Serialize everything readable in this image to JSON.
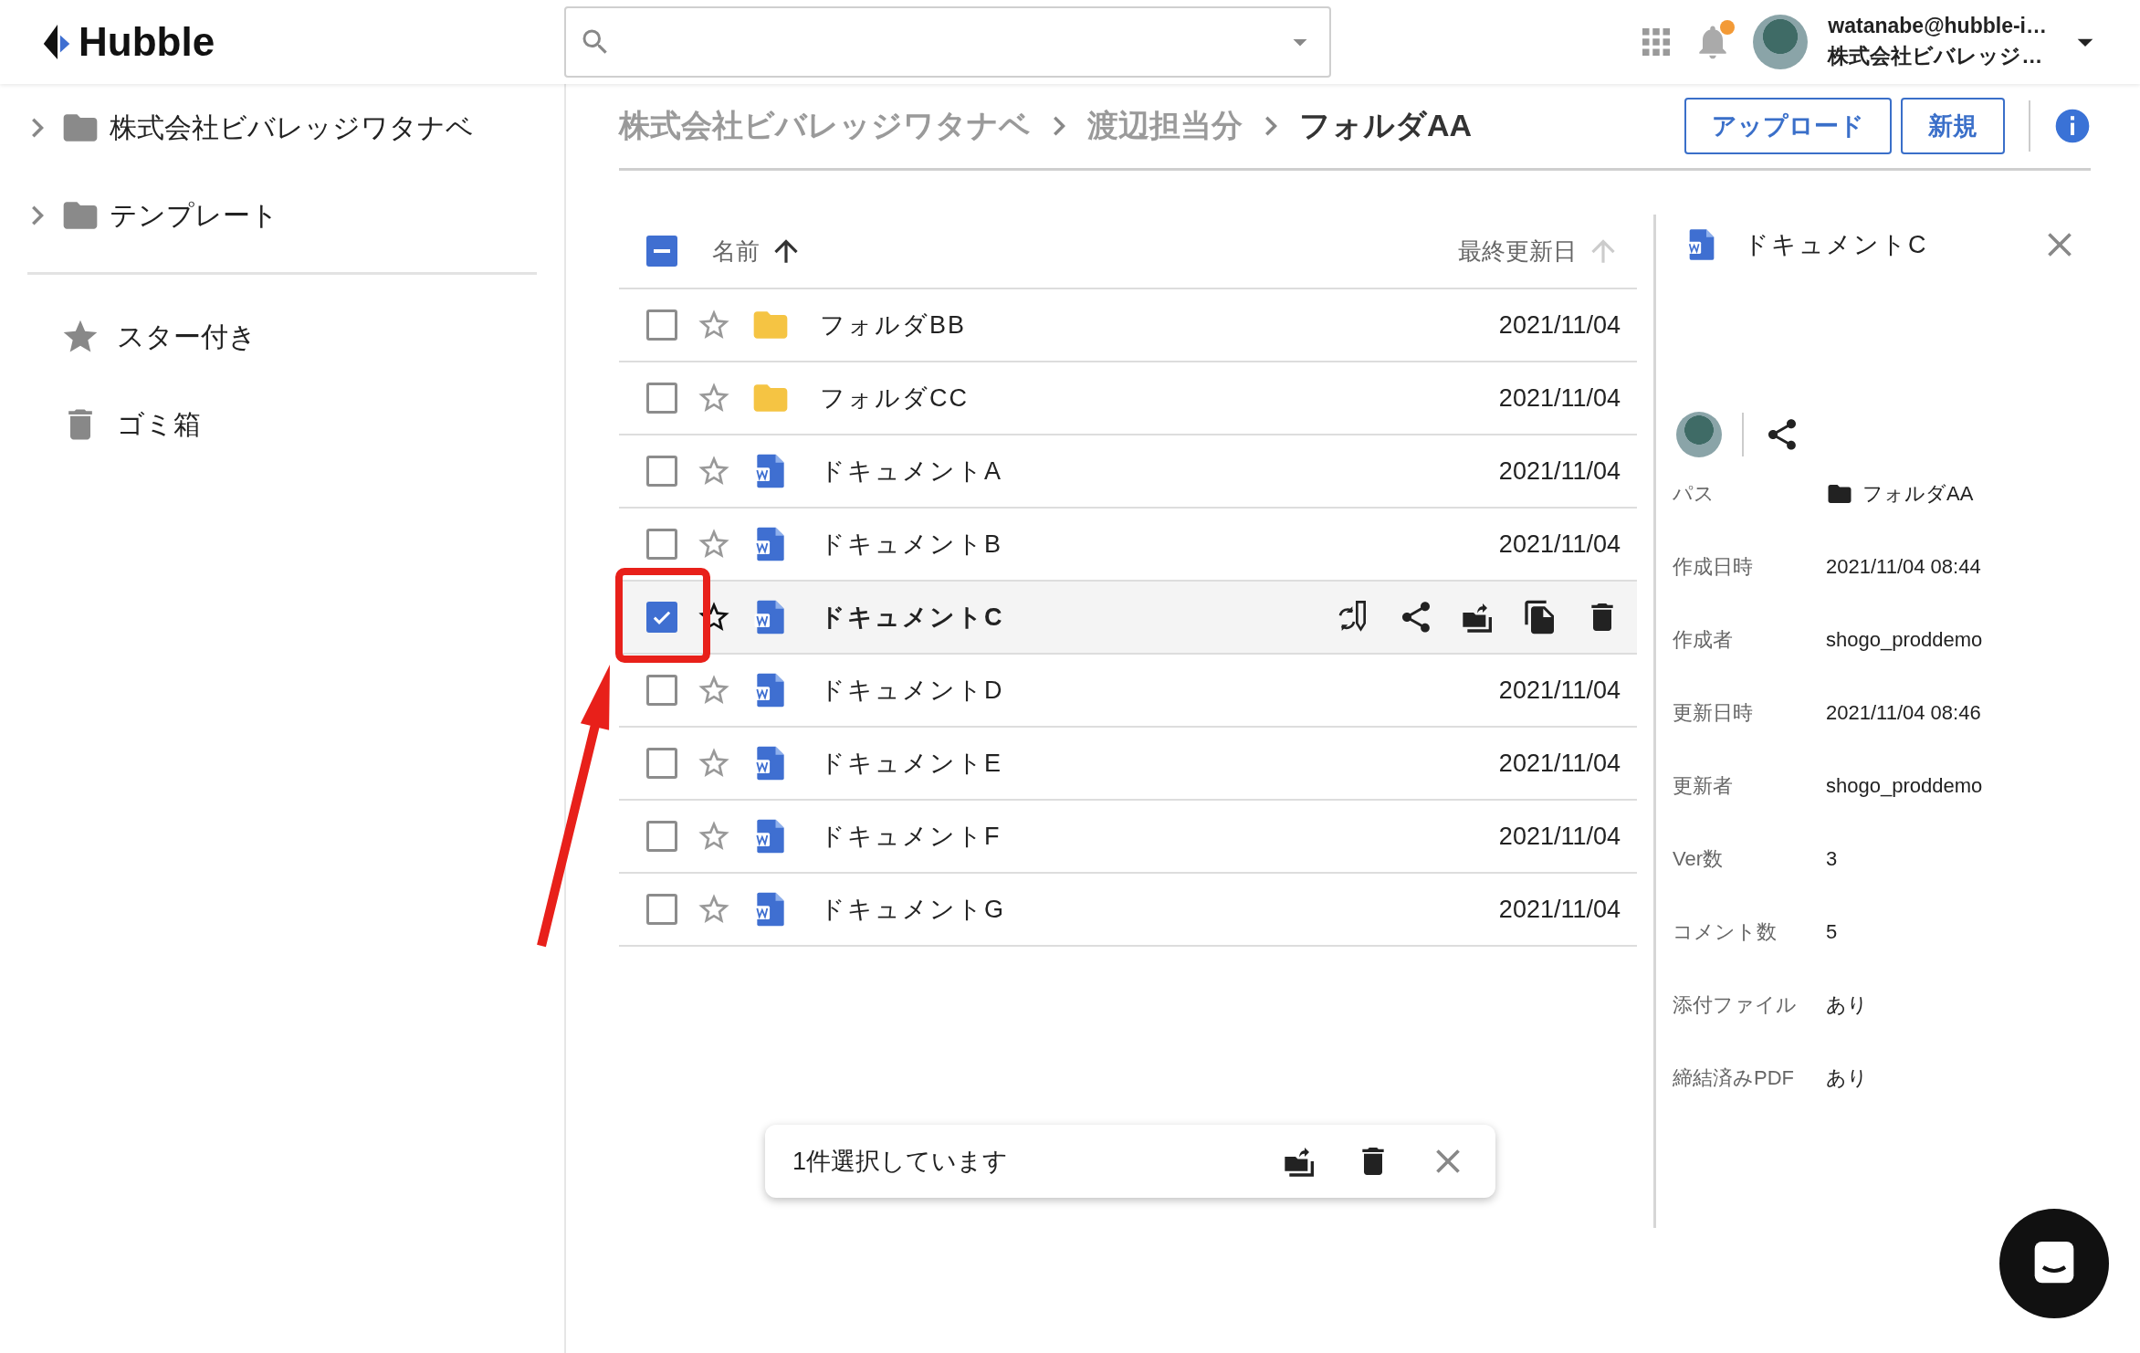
{
  "app": {
    "name": "Hubble"
  },
  "user": {
    "email": "watanabe@hubble-i…",
    "company": "株式会社ビバレッジ…"
  },
  "notifications": {
    "unread": true
  },
  "sidebar": {
    "tree": [
      {
        "label": "株式会社ビバレッジワタナベ",
        "expanded": false
      },
      {
        "label": "テンプレート",
        "expanded": false
      }
    ],
    "nav": [
      {
        "kind": "starred",
        "label": "スター付き"
      },
      {
        "kind": "trash",
        "label": "ゴミ箱"
      }
    ]
  },
  "breadcrumbs": [
    {
      "label": "株式会社ビバレッジワタナベ",
      "current": false
    },
    {
      "label": "渡辺担当分",
      "current": false
    },
    {
      "label": "フォルダAA",
      "current": true
    }
  ],
  "buttons": [
    "アップロード",
    "新規"
  ],
  "table": {
    "select_all_partial": true,
    "columns": [
      {
        "label": "名前",
        "sorted": true
      },
      {
        "label": "最終更新日",
        "sorted": false
      }
    ],
    "rows": [
      {
        "kind": "folder",
        "name": "フォルダBB",
        "date": "2021/11/04",
        "checked": false,
        "starred": false,
        "selected": false
      },
      {
        "kind": "folder",
        "name": "フォルダCC",
        "date": "2021/11/04",
        "checked": false,
        "starred": false,
        "selected": false
      },
      {
        "kind": "document",
        "name": "ドキュメントA",
        "date": "2021/11/04",
        "checked": false,
        "starred": false,
        "selected": false
      },
      {
        "kind": "document",
        "name": "ドキュメントB",
        "date": "2021/11/04",
        "checked": false,
        "starred": false,
        "selected": false
      },
      {
        "kind": "document",
        "name": "ドキュメントC",
        "checked": true,
        "starred": false,
        "selected": true
      },
      {
        "kind": "document",
        "name": "ドキュメントD",
        "date": "2021/11/04",
        "checked": false,
        "starred": false,
        "selected": false
      },
      {
        "kind": "document",
        "name": "ドキュメントE",
        "date": "2021/11/04",
        "checked": false,
        "starred": false,
        "selected": false
      },
      {
        "kind": "document",
        "name": "ドキュメントF",
        "date": "2021/11/04",
        "checked": false,
        "starred": false,
        "selected": false
      },
      {
        "kind": "document",
        "name": "ドキュメントG",
        "date": "2021/11/04",
        "checked": false,
        "starred": false,
        "selected": false
      }
    ]
  },
  "details": {
    "title": "ドキュメントC",
    "fields": [
      {
        "label": "パス",
        "value": "フォルダAA",
        "kind": "folder"
      },
      {
        "label": "作成日時",
        "value": "2021/11/04 08:44",
        "kind": "text"
      },
      {
        "label": "作成者",
        "value": "shogo_proddemo",
        "kind": "text"
      },
      {
        "label": "更新日時",
        "value": "2021/11/04 08:46",
        "kind": "text"
      },
      {
        "label": "更新者",
        "value": "shogo_proddemo",
        "kind": "text"
      },
      {
        "label": "Ver数",
        "value": "3",
        "kind": "text"
      },
      {
        "label": "コメント数",
        "value": "5",
        "kind": "text"
      },
      {
        "label": "添付ファイル",
        "value": "あり",
        "kind": "text"
      },
      {
        "label": "締結済みPDF",
        "value": "あり",
        "kind": "text"
      }
    ]
  },
  "snackbar": {
    "text": "1件選択しています"
  }
}
